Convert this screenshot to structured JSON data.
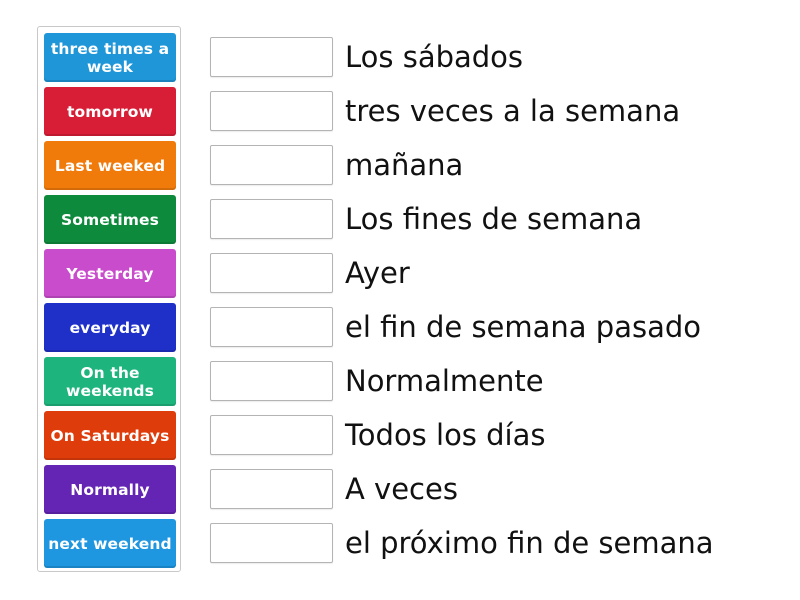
{
  "tiles": [
    {
      "label": "three times a week",
      "color": "#1e96d8"
    },
    {
      "label": "tomorrow",
      "color": "#d81e36"
    },
    {
      "label": "Last weeked",
      "color": "#f07a0a"
    },
    {
      "label": "Sometimes",
      "color": "#0e8a3c"
    },
    {
      "label": "Yesterday",
      "color": "#c84ccc"
    },
    {
      "label": "everyday",
      "color": "#1e30c8"
    },
    {
      "label": "On the weekends",
      "color": "#1eb47e"
    },
    {
      "label": "On Saturdays",
      "color": "#de3c0a"
    },
    {
      "label": "Normally",
      "color": "#6424b4"
    },
    {
      "label": "next weekend",
      "color": "#1e96e0"
    }
  ],
  "prompts": [
    {
      "text": "Los sábados",
      "answer": ""
    },
    {
      "text": "tres veces a la semana",
      "answer": ""
    },
    {
      "text": "mañana",
      "answer": ""
    },
    {
      "text": "Los fines de semana",
      "answer": ""
    },
    {
      "text": "Ayer",
      "answer": ""
    },
    {
      "text": "el fin de semana pasado",
      "answer": ""
    },
    {
      "text": "Normalmente",
      "answer": ""
    },
    {
      "text": "Todos los días",
      "answer": ""
    },
    {
      "text": "A veces",
      "answer": ""
    },
    {
      "text": "el próximo fin de semana",
      "answer": ""
    }
  ]
}
